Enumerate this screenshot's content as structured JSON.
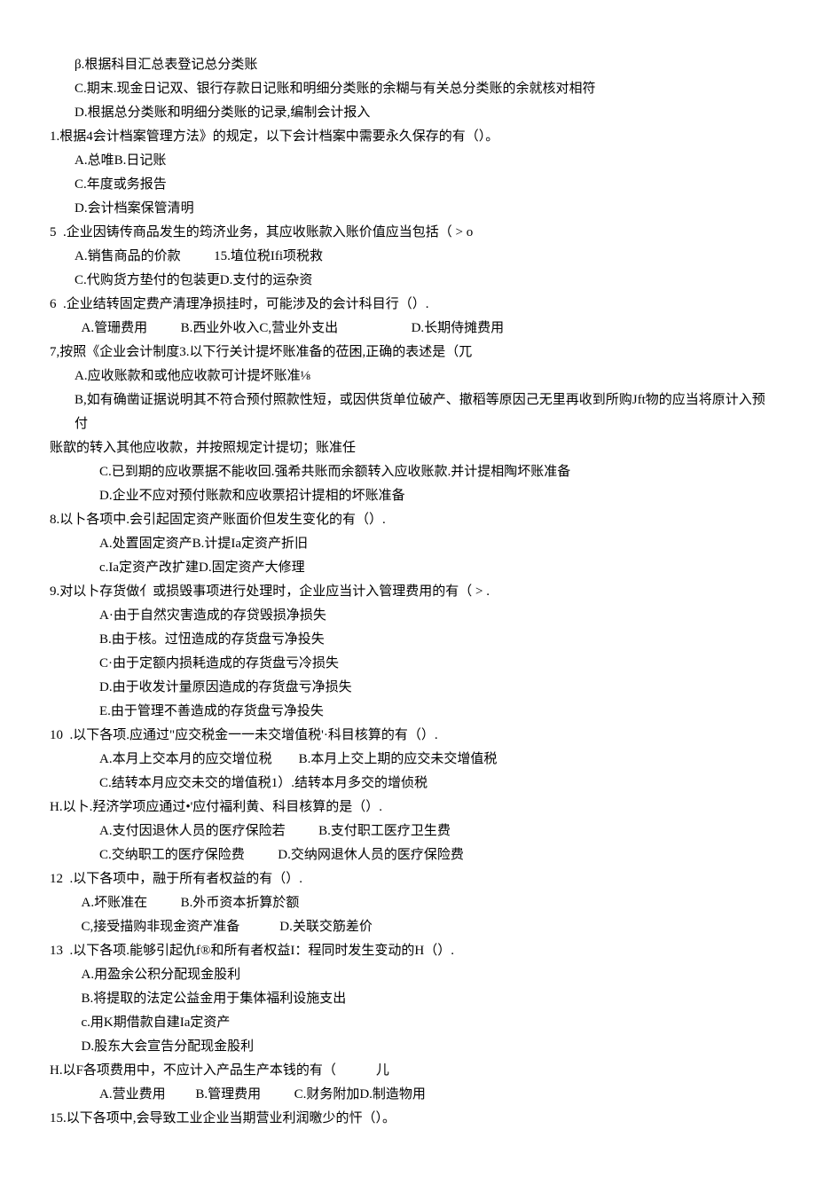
{
  "lines": [
    {
      "cls": "indent1",
      "text": "β.根据科目汇总表登记总分类账"
    },
    {
      "cls": "indent1",
      "text": "C.期末.现金日记双、银行存款日记账和明细分类账的余糊与有关总分类账的余就核对相符"
    },
    {
      "cls": "indent1",
      "text": "D.根据总分类账和明细分类账的记录,编制会计报入"
    },
    {
      "cls": "stem",
      "text": "1.根据4会计档案管理方法》的规定，以下会计档案中需要永久保存的有（）。"
    },
    {
      "cls": "indent1",
      "text": "A.总唯B.日记账"
    },
    {
      "cls": "indent1",
      "text": "C.年度或务报告"
    },
    {
      "cls": "indent1",
      "text": "D.会计档案保管清明"
    },
    {
      "cls": "stem",
      "text": "5  .企业因铸传商品发生的筠济业务，其应收账款入账价值应当包括（ > o"
    },
    {
      "cls": "indent1",
      "text": "A.销售商品的价款          15.埴位税Ifi项税救"
    },
    {
      "cls": "indent1",
      "text": "C.代购货方垫付的包装更D.支付的运杂资"
    },
    {
      "cls": "stem",
      "text": "6  .企业结转固定费产清理净损挂时，可能涉及的会计科目行（）."
    },
    {
      "cls": "indent1",
      "text": "  A.管珊费用          B.西业外收入C,营业外支出                      D.长期侍摊费用"
    },
    {
      "cls": "stem",
      "text": "7,按照《企业会计制度3.以下行关计提坏账准备的莅困,正确的表述是（兀"
    },
    {
      "cls": "indent1",
      "text": "A.应收账款和或他应收款可计提坏账准⅛"
    },
    {
      "cls": "indent1",
      "text": "B,如有确凿证据说明其不符合预付照款性短，或因供货单位破产、撤稻等原因己无里再收到所购Jft物的应当将原计入预付"
    },
    {
      "cls": "stem",
      "text": "账歆的转入其他应收款，并按照规定计提切；账准任"
    },
    {
      "cls": "indent2",
      "text": "C.已到期的应收票据不能收回.强希共账而余额转入应收账款.并计提相陶坏账准备"
    },
    {
      "cls": "indent2",
      "text": "D.企业不应对预付账款和应收票招计提相的坏账准备"
    },
    {
      "cls": "stem",
      "text": "8.以卜各项中.会引起固定资产账面价但发生变化的有（）."
    },
    {
      "cls": "indent2",
      "text": "A.处置固定资产B.计提Ia定资产折旧"
    },
    {
      "cls": "indent2",
      "text": "c.Ia定资产改扩建D.固定资产大修理"
    },
    {
      "cls": "stem",
      "text": "9.对以卜存货做亻或损毁事项进行处理时，企业应当计入管理费用的有（ > ."
    },
    {
      "cls": "indent2",
      "text": "A·由于自然灾害造成的存贷毁损净损失"
    },
    {
      "cls": "indent2",
      "text": "B.由于核。过忸造成的存货盘亏净投失"
    },
    {
      "cls": "indent2",
      "text": "C·由于定额内损耗造成的存货盘亏冷损失"
    },
    {
      "cls": "indent2",
      "text": "D.由于收发计量原因造成的存货盘亏净损失"
    },
    {
      "cls": "indent2",
      "text": "E.由于管理不善造成的存货盘亏净投失"
    },
    {
      "cls": "stem",
      "text": "10  .以下各项.应通过\"应交税金一一未交增值税'·科目核算的有（）."
    },
    {
      "cls": "indent2",
      "text": "A.本月上交本月的应交增位税        B.本月上交上期的应交未交增值税"
    },
    {
      "cls": "indent2",
      "text": "C.结转本月应交未交的增值税1）.结转本月多交的增侦税"
    },
    {
      "cls": "stem",
      "text": "H.以卜.羟济学项应通过•'应付福利黄、科目核算的是（）."
    },
    {
      "cls": "indent2",
      "text": "A.支付因退休人员的医疗保险若          B.支付职工医疗卫生费"
    },
    {
      "cls": "indent2",
      "text": "C.交纳职工的医疗保险费          D.交纳网退休人员的医疗保险费"
    },
    {
      "cls": "stem",
      "text": "12  .以下各项中，融于所有者权益的有（）."
    },
    {
      "cls": "indent1",
      "text": "  A.坏账准在          B.外币资本折算於额"
    },
    {
      "cls": "indent1",
      "text": "  C,接受描购非现金资产准备            D.关联交筋差价"
    },
    {
      "cls": "stem",
      "text": "13  .以下各项.能够引起仇f®和所有者权益I：程同时发生变动的H（）."
    },
    {
      "cls": "indent1",
      "text": "  A.用盈余公积分配现金股利"
    },
    {
      "cls": "indent1",
      "text": "  B.将提取的法定公益金用于集体福利设施支出"
    },
    {
      "cls": "indent1",
      "text": "  c.用K期借款自建Ia定资产"
    },
    {
      "cls": "indent1",
      "text": "  D.股东大会宣告分配现金股利"
    },
    {
      "cls": "stem",
      "text": "H.以F各项费用中，不应计入产品生产本钱的有（            儿"
    },
    {
      "cls": "indent2",
      "text": "A.营业费用         B.管理费用          C.财务附加D.制造物用"
    },
    {
      "cls": "stem",
      "text": "15.以下各项中,会导致工业企业当期营业利润曒少的忓（）。"
    }
  ]
}
